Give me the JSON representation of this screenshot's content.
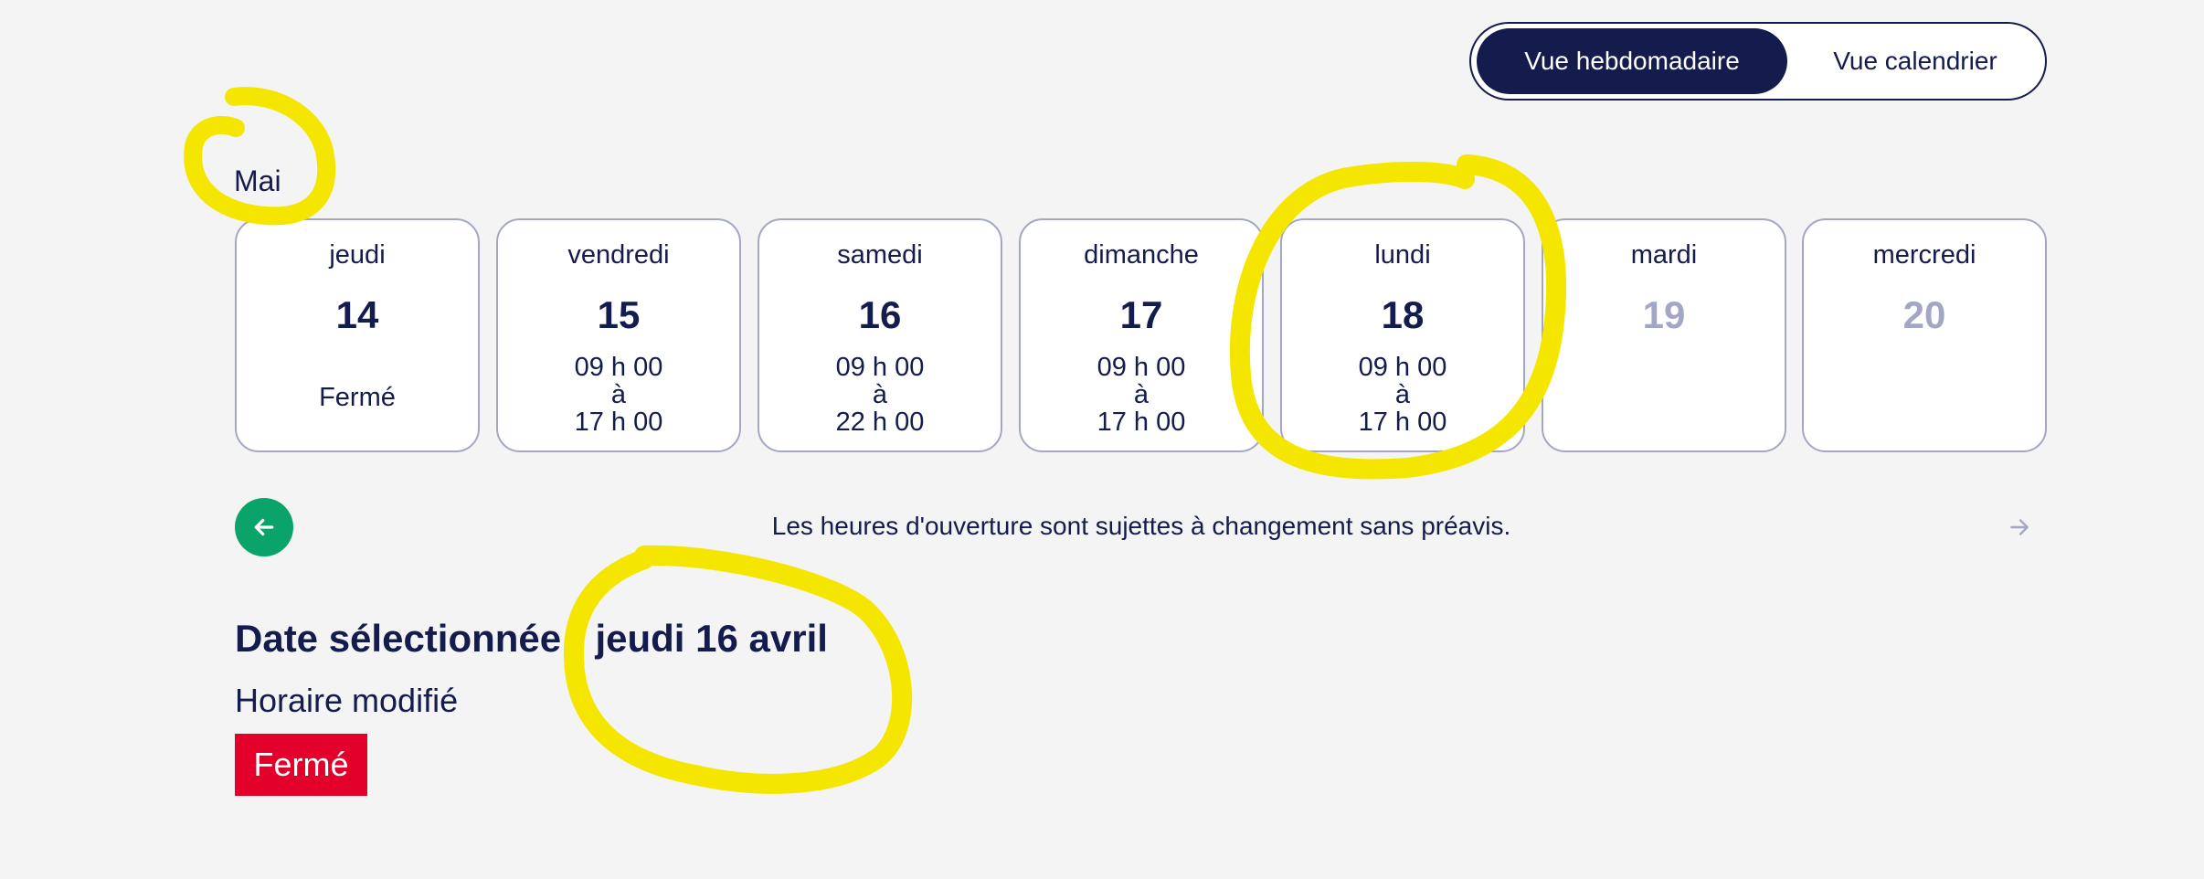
{
  "view_toggle": {
    "weekly_label": "Vue hebdomadaire",
    "calendar_label": "Vue calendrier"
  },
  "month": "Mai",
  "days": [
    {
      "name": "jeudi",
      "number": "14",
      "status": "Fermé",
      "enabled": true
    },
    {
      "name": "vendredi",
      "number": "15",
      "open": "09 h 00",
      "to": "à",
      "close": "17 h 00",
      "enabled": true
    },
    {
      "name": "samedi",
      "number": "16",
      "open": "09 h 00",
      "to": "à",
      "close": "22 h 00",
      "enabled": true
    },
    {
      "name": "dimanche",
      "number": "17",
      "open": "09 h 00",
      "to": "à",
      "close": "17 h 00",
      "enabled": true
    },
    {
      "name": "lundi",
      "number": "18",
      "open": "09 h 00",
      "to": "à",
      "close": "17 h 00",
      "enabled": true
    },
    {
      "name": "mardi",
      "number": "19",
      "enabled": false
    },
    {
      "name": "mercredi",
      "number": "20",
      "enabled": false
    }
  ],
  "notice": "Les heures d'ouverture sont sujettes à changement sans préavis.",
  "selection": {
    "title": "Date sélectionnée : jeudi 16 avril",
    "schedule_status": "Horaire modifié",
    "closed_badge": "Fermé"
  },
  "colors": {
    "navy": "#141b4d",
    "green": "#0aa36a",
    "red": "#e3002b",
    "muted": "#a3a7c4",
    "highlight": "#f5e600"
  },
  "icons": {
    "prev": "arrow-left-icon",
    "next": "arrow-right-icon"
  }
}
